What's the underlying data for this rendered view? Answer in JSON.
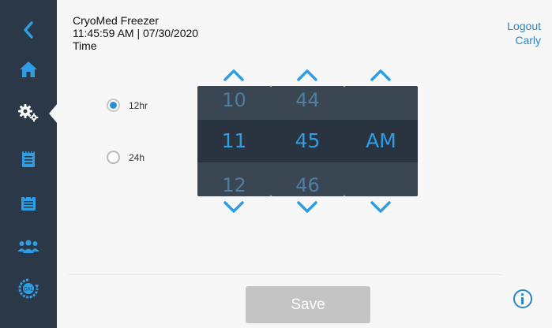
{
  "header": {
    "device": "CryoMed Freezer",
    "datetime": "11:45:59 AM | 07/30/2020",
    "page": "Time"
  },
  "account": {
    "logout": "Logout",
    "user": "Carly"
  },
  "format": {
    "opt12": "12hr",
    "opt24": "24h",
    "selected": "12hr"
  },
  "picker": {
    "hour": {
      "prev": "10",
      "current": "11",
      "next": "12"
    },
    "minute": {
      "prev": "44",
      "current": "45",
      "next": "46"
    },
    "period": {
      "prev": "",
      "current": "AM",
      "next": ""
    }
  },
  "actions": {
    "save": "Save"
  },
  "sidebar": {
    "items": [
      "back-icon",
      "home-icon",
      "settings-icon",
      "notepad-icon",
      "calendar-icon",
      "users-icon",
      "calibration-icon"
    ]
  },
  "colors": {
    "sidebar": "#2b3848",
    "accent": "#2e9de3",
    "picker_bg": "#3a4652",
    "picker_band": "#2a3440",
    "save_disabled": "#c4c4c4"
  }
}
